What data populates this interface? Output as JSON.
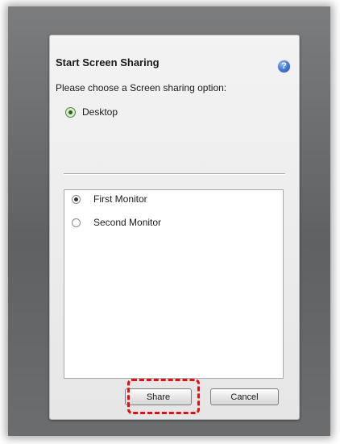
{
  "dialog": {
    "title": "Start Screen Sharing",
    "help_icon": "help-icon",
    "prompt": "Please choose a Screen sharing option:",
    "primary_option": {
      "label": "Desktop",
      "selected": true
    },
    "monitors": [
      {
        "label": "First Monitor",
        "selected": true
      },
      {
        "label": "Second Monitor",
        "selected": false
      }
    ],
    "buttons": {
      "share_label": "Share",
      "cancel_label": "Cancel"
    }
  },
  "colors": {
    "highlight": "#e01010",
    "selected_radio": "#4f8a3a",
    "help_icon": "#3d75cf"
  }
}
